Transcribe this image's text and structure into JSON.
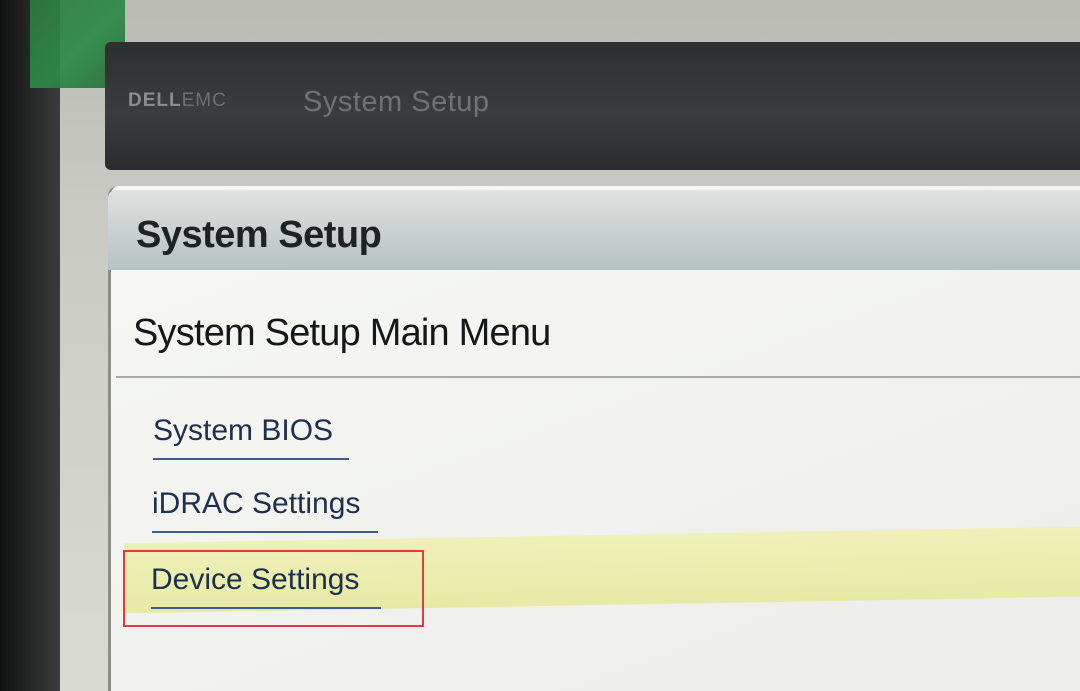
{
  "header": {
    "brand_main": "DELL",
    "brand_sub": "EMC",
    "title": "System Setup"
  },
  "panel": {
    "title": "System Setup",
    "section_title": "System Setup Main Menu"
  },
  "menu": {
    "items": [
      {
        "label": "System BIOS"
      },
      {
        "label": "iDRAC Settings"
      },
      {
        "label": "Device Settings"
      }
    ],
    "selected_index": 2
  },
  "colors": {
    "header_bg": "#2d2f31",
    "highlight": "#e7eaa5",
    "link": "#1c2f4d",
    "selection_outline": "#e23b3b"
  }
}
